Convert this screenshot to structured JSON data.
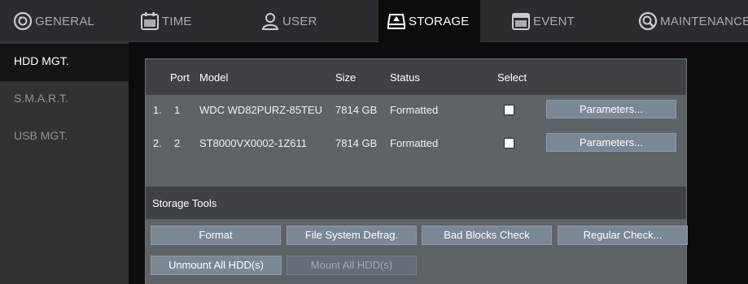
{
  "tabs": [
    {
      "label": "GENERAL",
      "icon": "gear-icon",
      "active": false
    },
    {
      "label": "TIME",
      "icon": "calendar-icon",
      "active": false
    },
    {
      "label": "USER",
      "icon": "user-icon",
      "active": false
    },
    {
      "label": "STORAGE",
      "icon": "storage-icon",
      "active": true
    },
    {
      "label": "EVENT",
      "icon": "event-icon",
      "active": false
    },
    {
      "label": "MAINTENANCE",
      "icon": "maintenance-icon",
      "active": false
    }
  ],
  "sidebar": {
    "items": [
      {
        "label": "HDD MGT.",
        "active": true
      },
      {
        "label": "S.M.A.R.T.",
        "active": false
      },
      {
        "label": "USB MGT.",
        "active": false
      }
    ]
  },
  "table": {
    "headers": {
      "port": "Port",
      "model": "Model",
      "size": "Size",
      "status": "Status",
      "select": "Select"
    },
    "rows": [
      {
        "index": "1.",
        "port": "1",
        "model": "WDC WD82PURZ-85TEU",
        "size": "7814 GB",
        "status": "Formatted",
        "selected": false,
        "action": "Parameters..."
      },
      {
        "index": "2.",
        "port": "2",
        "model": "ST8000VX0002-1Z611",
        "size": "7814 GB",
        "status": "Formatted",
        "selected": false,
        "action": "Parameters..."
      }
    ]
  },
  "tools": {
    "title": "Storage Tools",
    "format": "Format",
    "defrag": "File System Defrag.",
    "bad_blocks": "Bad Blocks Check",
    "regular": "Regular Check...",
    "unmount_all": "Unmount All HDD(s)",
    "mount_all": "Mount All HDD(s)"
  },
  "colors": {
    "active_tab_bg": "#0c0c0d",
    "panel_bg": "#5e6368",
    "header_bg": "#3e4245",
    "button_bg": "#7a8795"
  }
}
